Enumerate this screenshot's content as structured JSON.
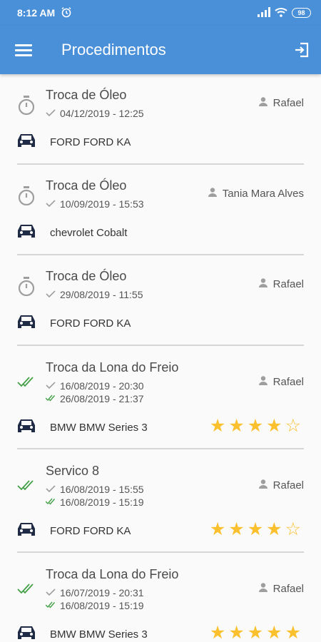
{
  "status_bar": {
    "time": "8:12 AM",
    "battery": "98"
  },
  "app_bar": {
    "title": "Procedimentos",
    "menu_icon": "menu-icon",
    "exit_icon": "exit-icon"
  },
  "colors": {
    "primary": "#4a90d9",
    "check_green": "#43a047",
    "star": "#fbc02d",
    "car_icon": "#1f2a44"
  },
  "items": [
    {
      "title": "Troca de Óleo",
      "status": "pending",
      "user": "Rafael",
      "dates": [
        "04/12/2019 - 12:25"
      ],
      "vehicle": "FORD FORD KA"
    },
    {
      "title": "Troca de Óleo",
      "status": "pending",
      "user": "Tania Mara Alves",
      "dates": [
        "10/09/2019 - 15:53"
      ],
      "vehicle": "chevrolet Cobalt"
    },
    {
      "title": "Troca de Óleo",
      "status": "pending",
      "user": "Rafael",
      "dates": [
        "29/08/2019 - 11:55"
      ],
      "vehicle": "FORD FORD KA"
    },
    {
      "title": "Troca da Lona do Freio",
      "status": "done",
      "user": "Rafael",
      "dates": [
        "16/08/2019 - 20:30",
        "26/08/2019 - 21:37"
      ],
      "vehicle": "BMW BMW Series 3",
      "rating": 4
    },
    {
      "title": "Servico 8",
      "status": "done",
      "user": "Rafael",
      "dates": [
        "16/08/2019 - 15:55",
        "16/08/2019 - 15:19"
      ],
      "vehicle": "FORD FORD KA",
      "rating": 4
    },
    {
      "title": "Troca da Lona do Freio",
      "status": "done",
      "user": "Rafael",
      "dates": [
        "16/07/2019 - 20:31",
        "16/08/2019 - 15:19"
      ],
      "vehicle": "BMW BMW Series 3",
      "rating": 5
    }
  ]
}
